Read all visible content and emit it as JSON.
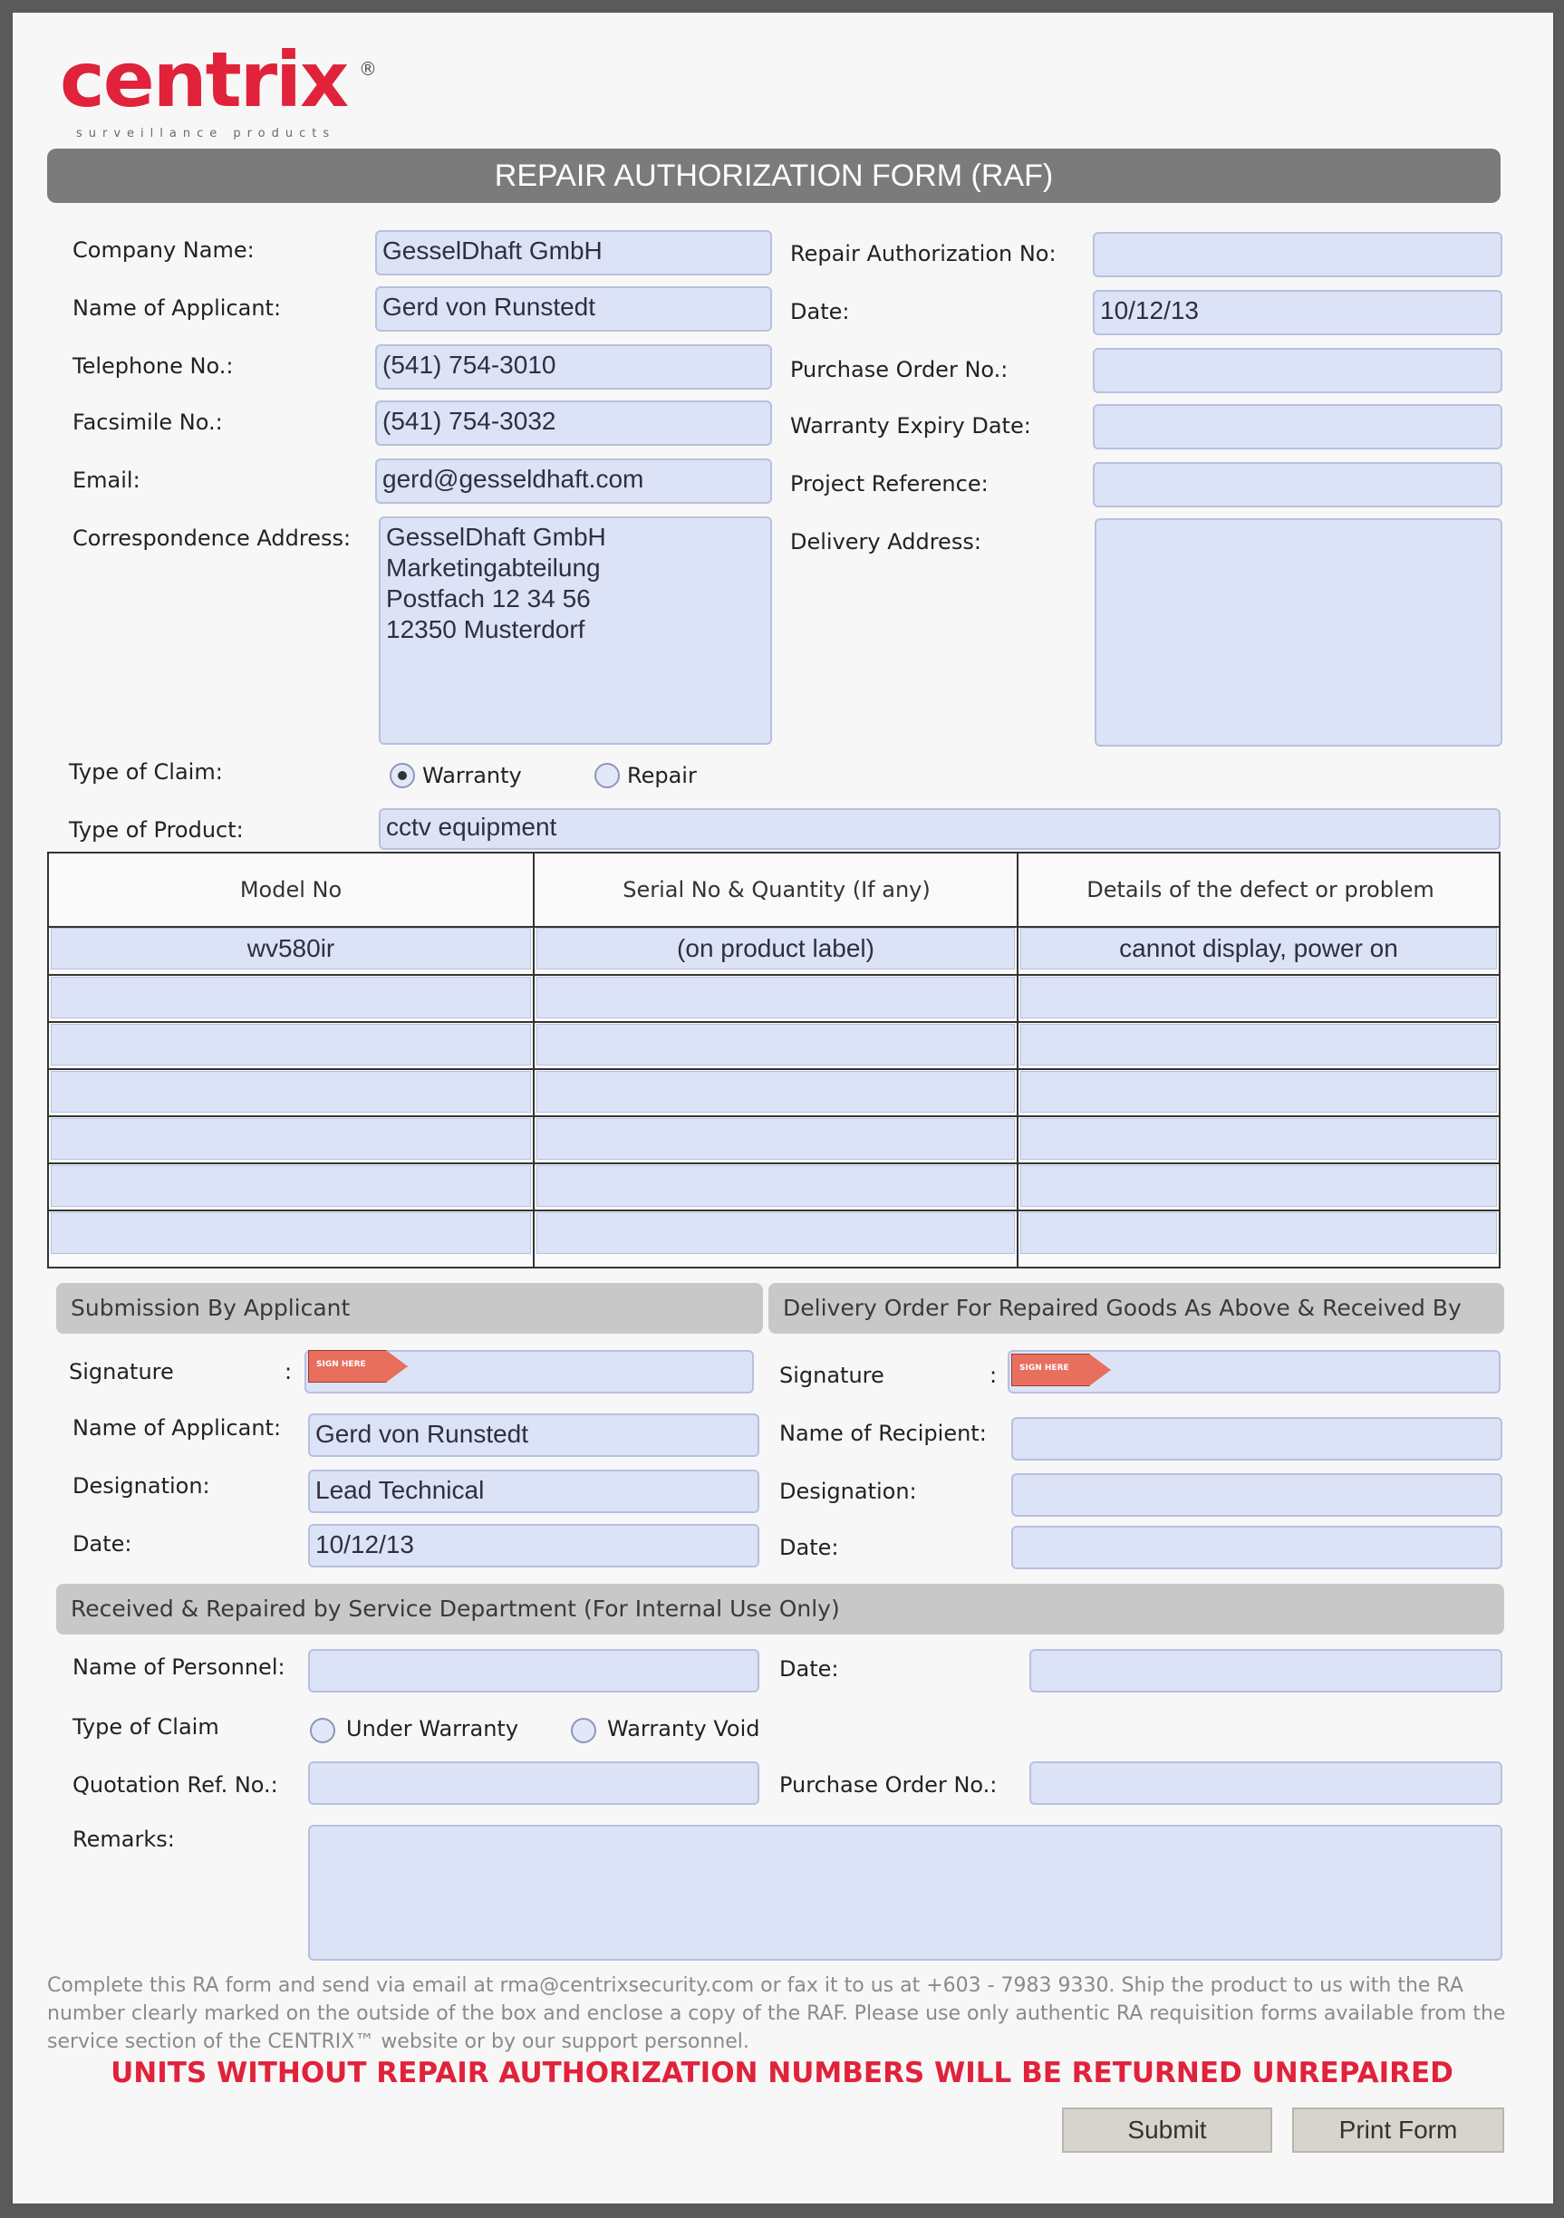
{
  "brand": {
    "logo_text": "centrix",
    "registered": "®",
    "tagline": "surveillance products"
  },
  "form_title": "REPAIR AUTHORIZATION FORM (RAF)",
  "left_fields": [
    {
      "label": "Company Name:",
      "value": "GesselDhaft GmbH"
    },
    {
      "label": "Name of Applicant:",
      "value": "Gerd von Runstedt"
    },
    {
      "label": "Telephone No.:",
      "value": "(541) 754-3010"
    },
    {
      "label": "Facsimile No.:",
      "value": "(541) 754-3032"
    },
    {
      "label": "Email:",
      "value": "gerd@gesseldhaft.com"
    }
  ],
  "correspondence": {
    "label": "Correspondence Address:",
    "value": "GesselDhaft GmbH\nMarketingabteilung\nPostfach 12 34 56\n12350 Musterdorf"
  },
  "right_fields": [
    {
      "label": "Repair Authorization No:",
      "value": ""
    },
    {
      "label": "Date:",
      "value": "10/12/13"
    },
    {
      "label": "Purchase Order No.:",
      "value": ""
    },
    {
      "label": "Warranty Expiry Date:",
      "value": ""
    },
    {
      "label": "Project Reference:",
      "value": ""
    }
  ],
  "delivery": {
    "label": "Delivery Address:",
    "value": ""
  },
  "claim": {
    "label": "Type of Claim:",
    "options": [
      "Warranty",
      "Repair"
    ],
    "selected": "Warranty"
  },
  "product": {
    "label": "Type of Product:",
    "value": "cctv equipment"
  },
  "products_table": {
    "headers": [
      "Model No",
      "Serial No & Quantity (If any)",
      "Details of the defect or problem"
    ],
    "rows": [
      [
        "wv580ir",
        "(on product label)",
        "cannot display, power on"
      ],
      [
        "",
        "",
        ""
      ],
      [
        "",
        "",
        ""
      ],
      [
        "",
        "",
        ""
      ],
      [
        "",
        "",
        ""
      ],
      [
        "",
        "",
        ""
      ],
      [
        "",
        "",
        ""
      ]
    ]
  },
  "submission": {
    "title": "Submission By Applicant",
    "signature_label": "Signature",
    "signature_colon": ":",
    "sign_tag": "SIGN HERE",
    "name_label": "Name of Applicant:",
    "name_value": "Gerd von Runstedt",
    "designation_label": "Designation:",
    "designation_value": "Lead Technical",
    "date_label": "Date:",
    "date_value": "10/12/13"
  },
  "delivery_order": {
    "title": "Delivery Order For Repaired Goods As Above & Received By",
    "signature_label": "Signature",
    "signature_colon": ":",
    "sign_tag": "SIGN HERE",
    "name_label": "Name of Recipient:",
    "name_value": "",
    "designation_label": "Designation:",
    "designation_value": "",
    "date_label": "Date:",
    "date_value": ""
  },
  "internal": {
    "title": "Received & Repaired by Service Department (For Internal Use Only)",
    "personnel_label": "Name of Personnel:",
    "personnel_value": "",
    "date_label": "Date:",
    "date_value": "",
    "claim_label": "Type of Claim",
    "claim_options": [
      "Under Warranty",
      "Warranty Void"
    ],
    "quotation_label": "Quotation Ref. No.:",
    "quotation_value": "",
    "po_label": "Purchase Order No.:",
    "po_value": "",
    "remarks_label": "Remarks:",
    "remarks_value": ""
  },
  "footer_note": "Complete this RA form and send via email at rma@centrixsecurity.com or fax it to us at +603 - 7983 9330. Ship the product to us with the RA number clearly marked on the outside of the box and enclose a copy of the RAF. Please use only authentic RA requisition forms available from the service section of the CENTRIX™ website or by our support personnel.",
  "warning": "UNITS WITHOUT REPAIR AUTHORIZATION NUMBERS WILL BE RETURNED UNREPAIRED",
  "buttons": {
    "submit": "Submit",
    "print": "Print Form"
  }
}
